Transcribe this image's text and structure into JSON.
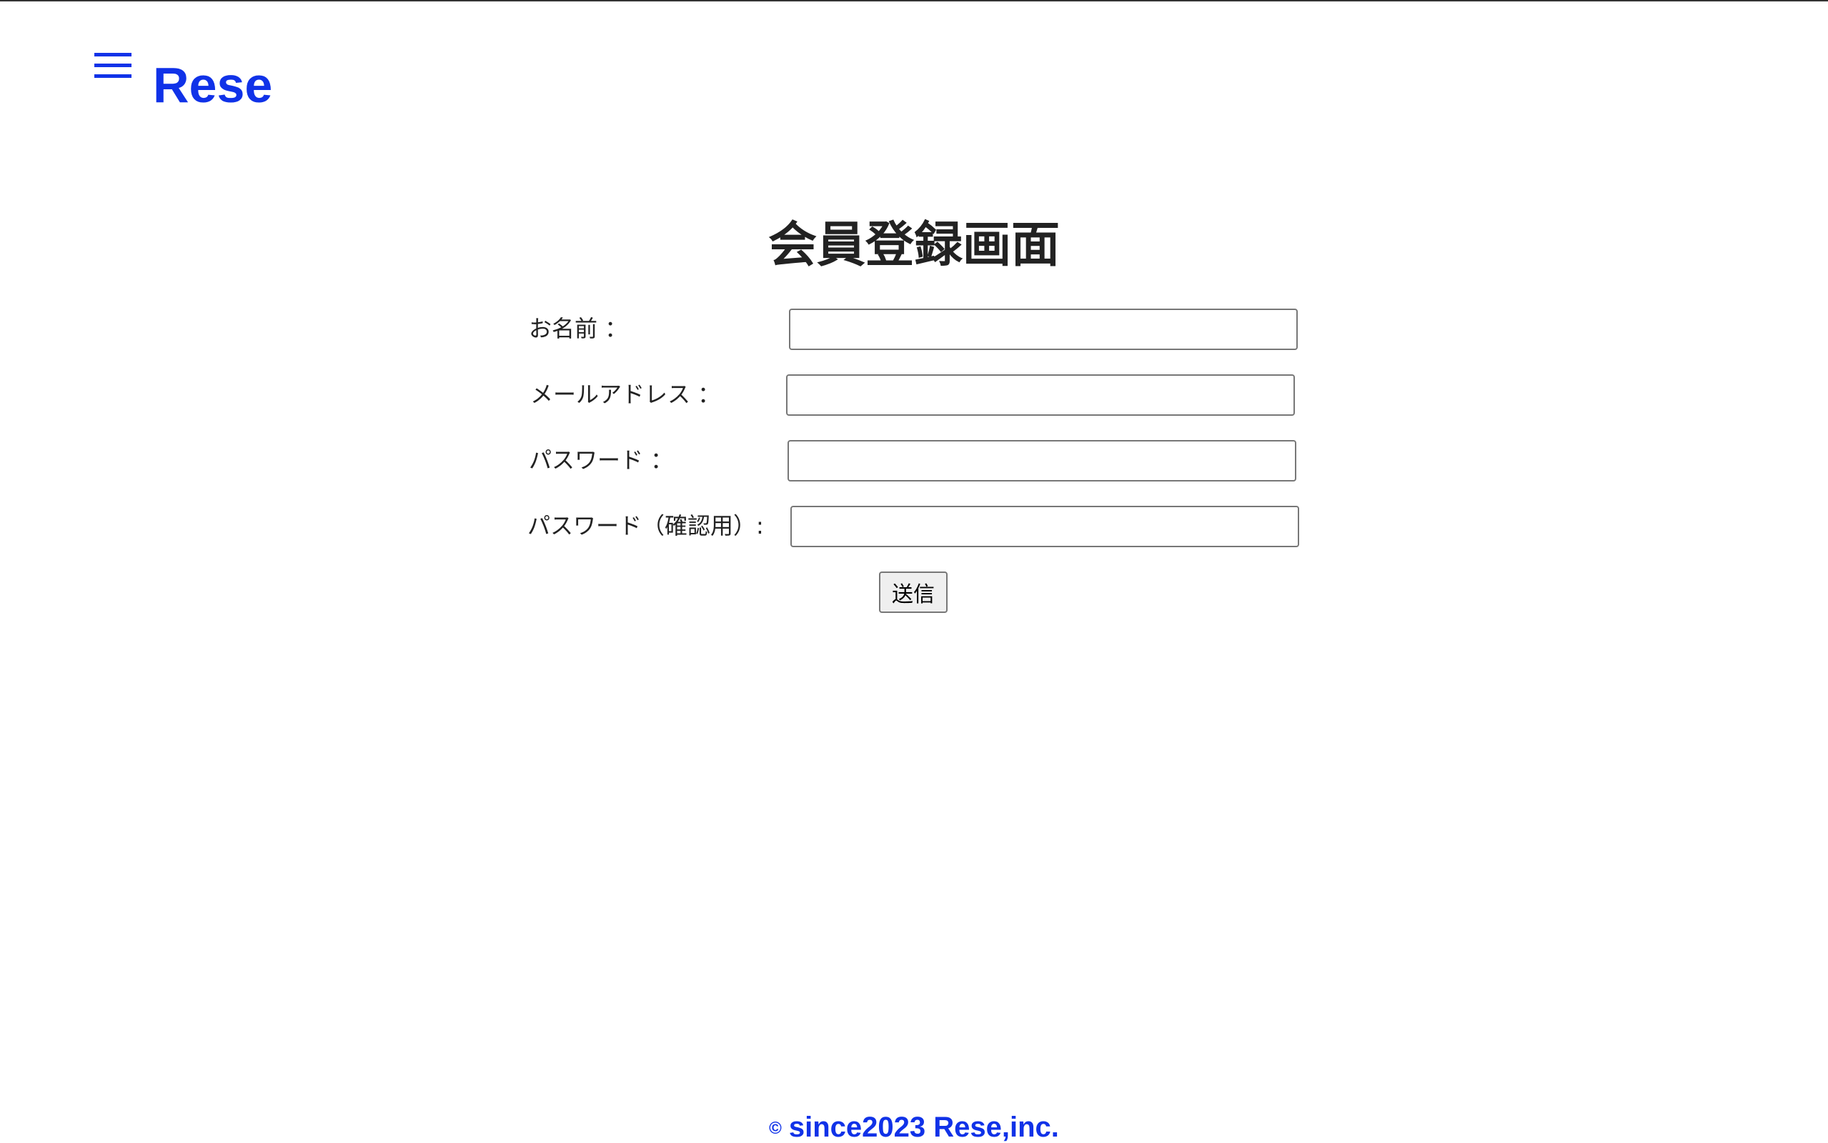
{
  "header": {
    "logo": "Rese",
    "menu_icon": "hamburger-menu-icon",
    "accent_color": "#1032e8"
  },
  "main": {
    "title": "会員登録画面",
    "fields": [
      {
        "label": "お名前 ：",
        "value": "",
        "type": "text"
      },
      {
        "label": "メールアドレス ：",
        "value": "",
        "type": "email"
      },
      {
        "label": "パスワード ：",
        "value": "",
        "type": "password"
      },
      {
        "label": "パスワード（確認用）:",
        "value": "",
        "type": "password"
      }
    ],
    "submit_label": "送信"
  },
  "footer": {
    "copyright_symbol": "©",
    "text": "since2023 Rese,inc."
  }
}
